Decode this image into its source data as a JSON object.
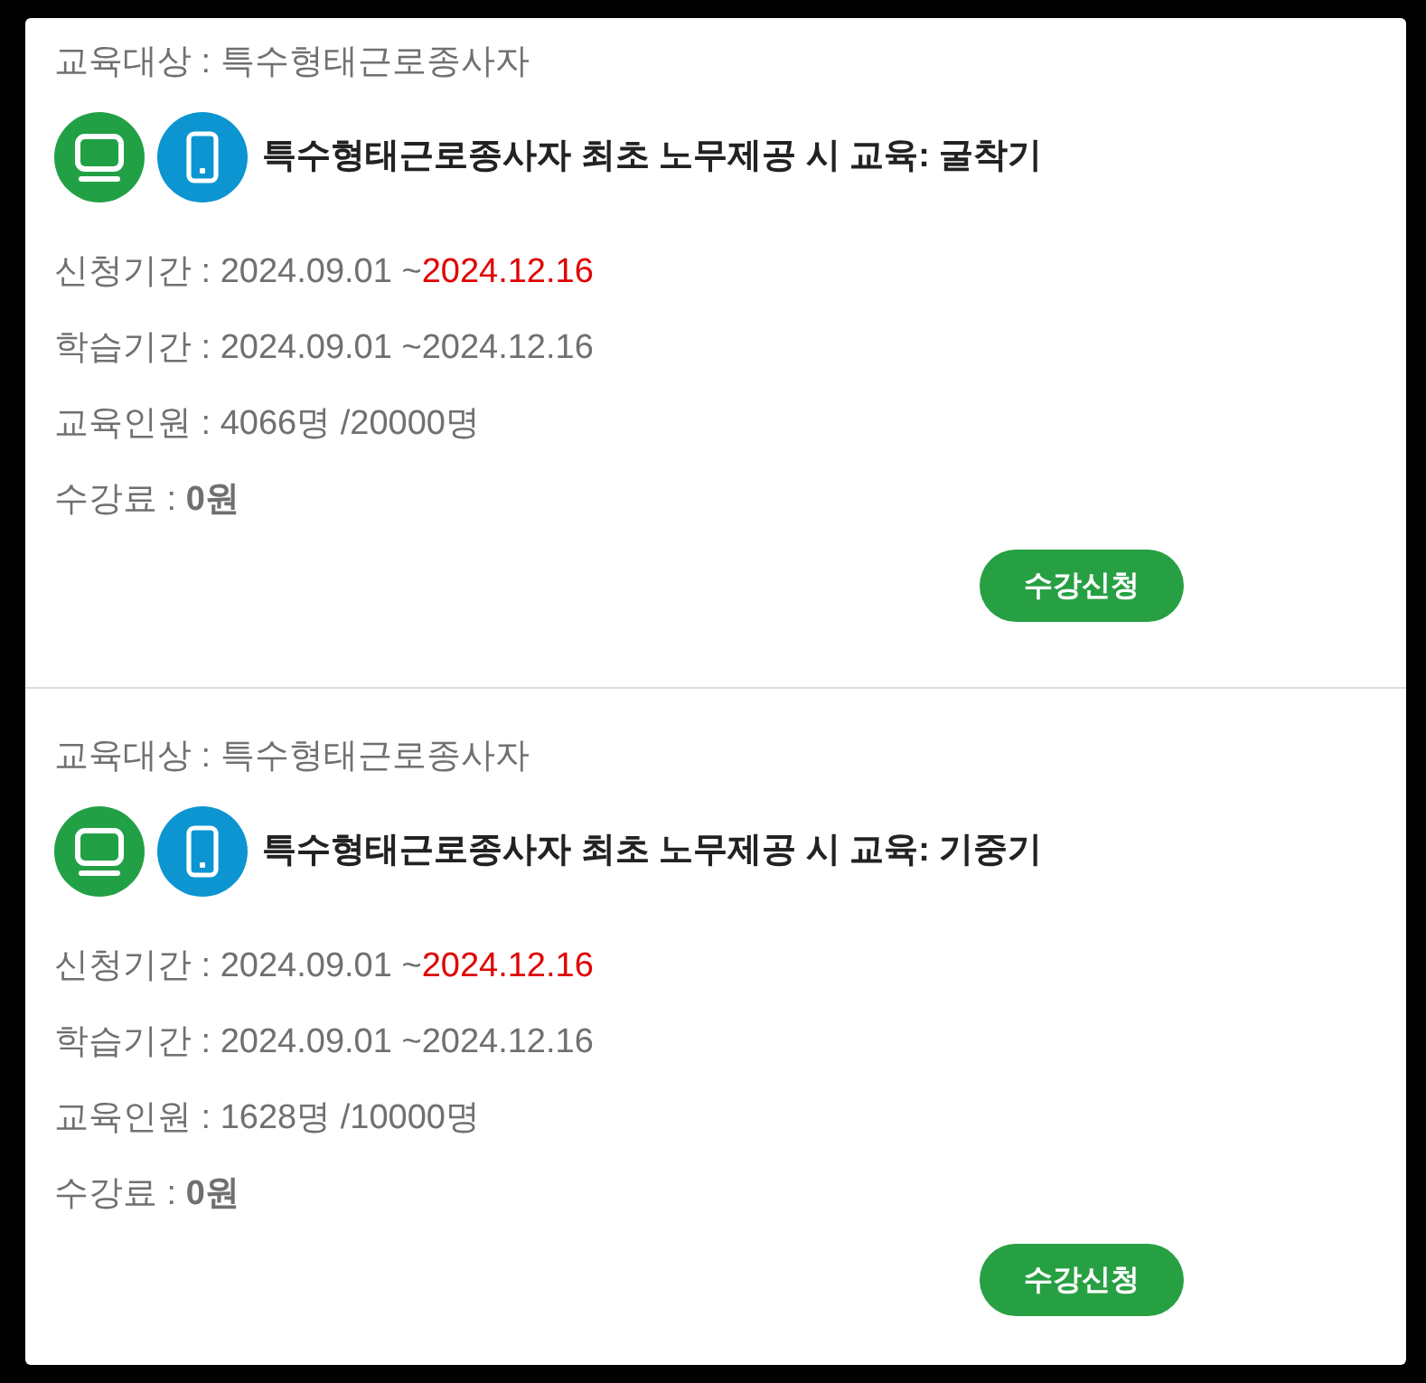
{
  "courses": [
    {
      "target": "교육대상 : 특수형태근로종사자",
      "platforms": [
        {
          "kind": "pc"
        },
        {
          "kind": "mobile"
        }
      ],
      "title": "특수형태근로종사자 최초 노무제공 시 교육: 굴착기",
      "details": [
        {
          "kind": "period",
          "label": "신청기간 :",
          "value": "2024.09.01 ~",
          "end": "2024.12.16",
          "end_emphasized": true
        },
        {
          "kind": "period",
          "label": "학습기간 :",
          "value": "2024.09.01 ~",
          "end": "2024.12.16",
          "end_emphasized": false
        },
        {
          "kind": "count",
          "label": "교육인원 :",
          "value": "4066명 /20000명"
        },
        {
          "kind": "fee",
          "label": "수강료 :",
          "value": "0원"
        }
      ],
      "button": "수강신청"
    },
    {
      "target": "교육대상 : 특수형태근로종사자",
      "platforms": [
        {
          "kind": "pc"
        },
        {
          "kind": "mobile"
        }
      ],
      "title": "특수형태근로종사자 최초 노무제공 시 교육: 기중기",
      "details": [
        {
          "kind": "period",
          "label": "신청기간 :",
          "value": "2024.09.01 ~",
          "end": "2024.12.16",
          "end_emphasized": true
        },
        {
          "kind": "period",
          "label": "학습기간 :",
          "value": "2024.09.01 ~",
          "end": "2024.12.16",
          "end_emphasized": false
        },
        {
          "kind": "count",
          "label": "교육인원 :",
          "value": "1628명 /10000명"
        },
        {
          "kind": "fee",
          "label": "수강료 :",
          "value": "0원"
        }
      ],
      "button": "수강신청"
    }
  ]
}
